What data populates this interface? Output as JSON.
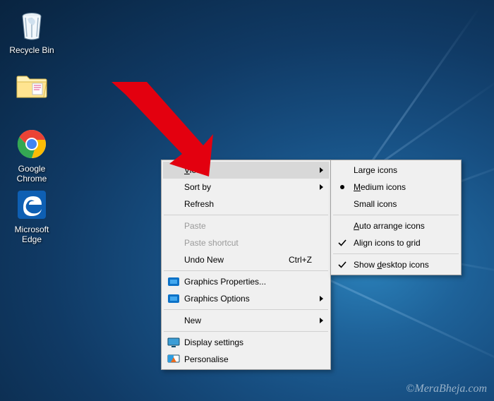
{
  "desktop_icons": {
    "recycle_bin": "Recycle Bin",
    "folder": "",
    "google_chrome": "Google Chrome",
    "microsoft_edge_line1": "Microsoft",
    "microsoft_edge_line2": "Edge"
  },
  "context_menu": {
    "view": {
      "label_pre": "",
      "label_mn": "V",
      "label_post": "iew"
    },
    "sort_by": "Sort by",
    "refresh": "Refresh",
    "paste": "Paste",
    "paste_shortcut": "Paste shortcut",
    "undo_new": "Undo New",
    "undo_shortcut": "Ctrl+Z",
    "graphics_properties": "Graphics Properties...",
    "graphics_options": "Graphics Options",
    "new": "New",
    "display_settings": "Display settings",
    "personalise": "Personalise"
  },
  "view_submenu": {
    "large_icons": "Large icons",
    "medium_icons_pre": "",
    "medium_icons_mn": "M",
    "medium_icons_post": "edium icons",
    "small_icons": "Small icons",
    "auto_arrange_pre": "",
    "auto_arrange_mn": "A",
    "auto_arrange_post": "uto arrange icons",
    "align_to_grid": "Align icons to grid",
    "show_desktop_pre": "Show ",
    "show_desktop_mn": "d",
    "show_desktop_post": "esktop icons",
    "selected": "medium",
    "align_checked": true,
    "show_checked": true
  },
  "watermark": "©MeraBheja.com",
  "colors": {
    "highlight_arrow": "#e3000f",
    "edge_blue": "#0e5fb3",
    "chrome_red": "#ea4335",
    "chrome_yellow": "#fbbc05",
    "chrome_green": "#34a853",
    "chrome_blue": "#4285f4",
    "intel_blue": "#0d72c7"
  }
}
